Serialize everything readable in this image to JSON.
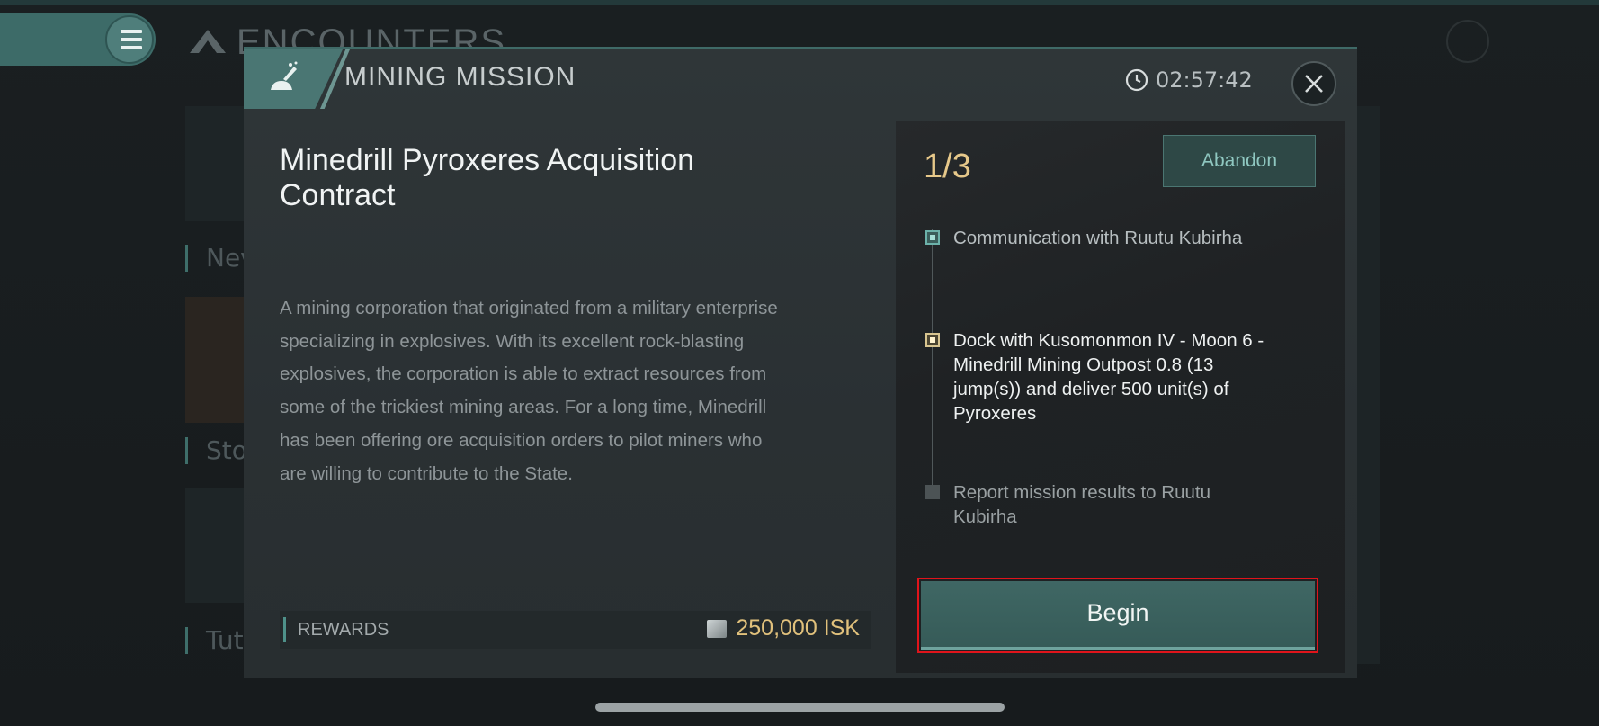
{
  "background": {
    "title": "ENCOUNTERS",
    "cards": [
      {
        "label": "Nev"
      },
      {
        "label": "Sto"
      },
      {
        "label": "Tut"
      }
    ]
  },
  "dialog": {
    "header_title": "MINING MISSION",
    "timer": "02:57:42",
    "contract_title": "Minedrill Pyroxeres Acquisition Contract",
    "description": "A mining corporation that originated from a military enterprise specializing in explosives. With its excellent rock-blasting explosives, the corporation is able to extract resources from some of the trickiest mining areas. For a long time, Minedrill has been offering ore acquisition orders to pilot miners who are willing to contribute to the State.",
    "rewards": {
      "label": "REWARDS",
      "amount": "250,000 ISK"
    },
    "objectives": {
      "progress": "1/3",
      "abandon_label": "Abandon",
      "steps": [
        {
          "text": "Communication with Ruutu Kubirha",
          "status": "completed"
        },
        {
          "text": "Dock with Kusomonmon IV - Moon 6 - Minedrill Mining Outpost 0.8 (13 jump(s)) and deliver 500 unit(s) of Pyroxeres",
          "status": "current"
        },
        {
          "text": "Report mission results to Ruutu Kubirha",
          "status": "pending"
        }
      ],
      "begin_label": "Begin"
    }
  },
  "colors": {
    "accent_teal": "#4a7673",
    "gold": "#e1c17c",
    "highlight_red": "#e0141b"
  }
}
